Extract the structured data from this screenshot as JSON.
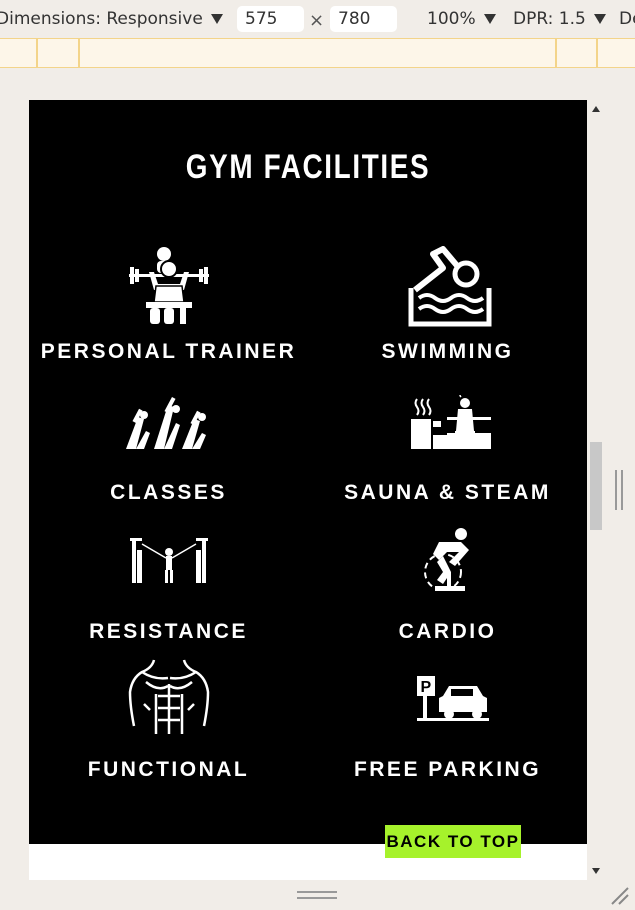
{
  "devtools": {
    "dimensions_label": "Dimensions: Responsive",
    "width_value": "575",
    "height_value": "780",
    "times_symbol": "×",
    "zoom_label": "100%",
    "dpr_label": "DPR: 1.5",
    "more_label": "De"
  },
  "page": {
    "heading": "GYM FACILITIES",
    "facilities": [
      {
        "label": "PERSONAL TRAINER",
        "icon": "personal-trainer-icon"
      },
      {
        "label": "SWIMMING",
        "icon": "swimming-icon"
      },
      {
        "label": "CLASSES",
        "icon": "classes-icon"
      },
      {
        "label": "SAUNA & STEAM",
        "icon": "sauna-icon"
      },
      {
        "label": "RESISTANCE",
        "icon": "resistance-icon"
      },
      {
        "label": "CARDIO",
        "icon": "cardio-icon"
      },
      {
        "label": "FUNCTIONAL",
        "icon": "functional-icon"
      },
      {
        "label": "FREE PARKING",
        "icon": "parking-icon"
      }
    ],
    "back_to_top": "BACK TO TOP"
  },
  "colors": {
    "page_background": "#000000",
    "accent": "#a6f22b",
    "text": "#ffffff"
  }
}
